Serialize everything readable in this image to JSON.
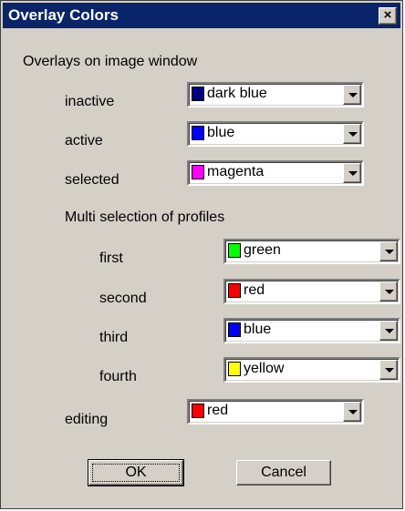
{
  "window": {
    "title": "Overlay Colors",
    "close_glyph": "×"
  },
  "section_label": "Overlays on image window",
  "rows": {
    "inactive": {
      "label": "inactive",
      "value": "dark blue",
      "color": "#000080"
    },
    "active": {
      "label": "active",
      "value": "blue",
      "color": "#0000ff"
    },
    "selected": {
      "label": "selected",
      "value": "magenta",
      "color": "#ff00ff"
    }
  },
  "multi_label": "Multi selection of profiles",
  "multi": {
    "first": {
      "label": "first",
      "value": "green",
      "color": "#00ff00"
    },
    "second": {
      "label": "second",
      "value": "red",
      "color": "#ff0000"
    },
    "third": {
      "label": "third",
      "value": "blue",
      "color": "#0000ff"
    },
    "fourth": {
      "label": "fourth",
      "value": "yellow",
      "color": "#ffff00"
    }
  },
  "editing": {
    "label": "editing",
    "value": "red",
    "color": "#ff0000"
  },
  "buttons": {
    "ok": "OK",
    "cancel": "Cancel"
  }
}
